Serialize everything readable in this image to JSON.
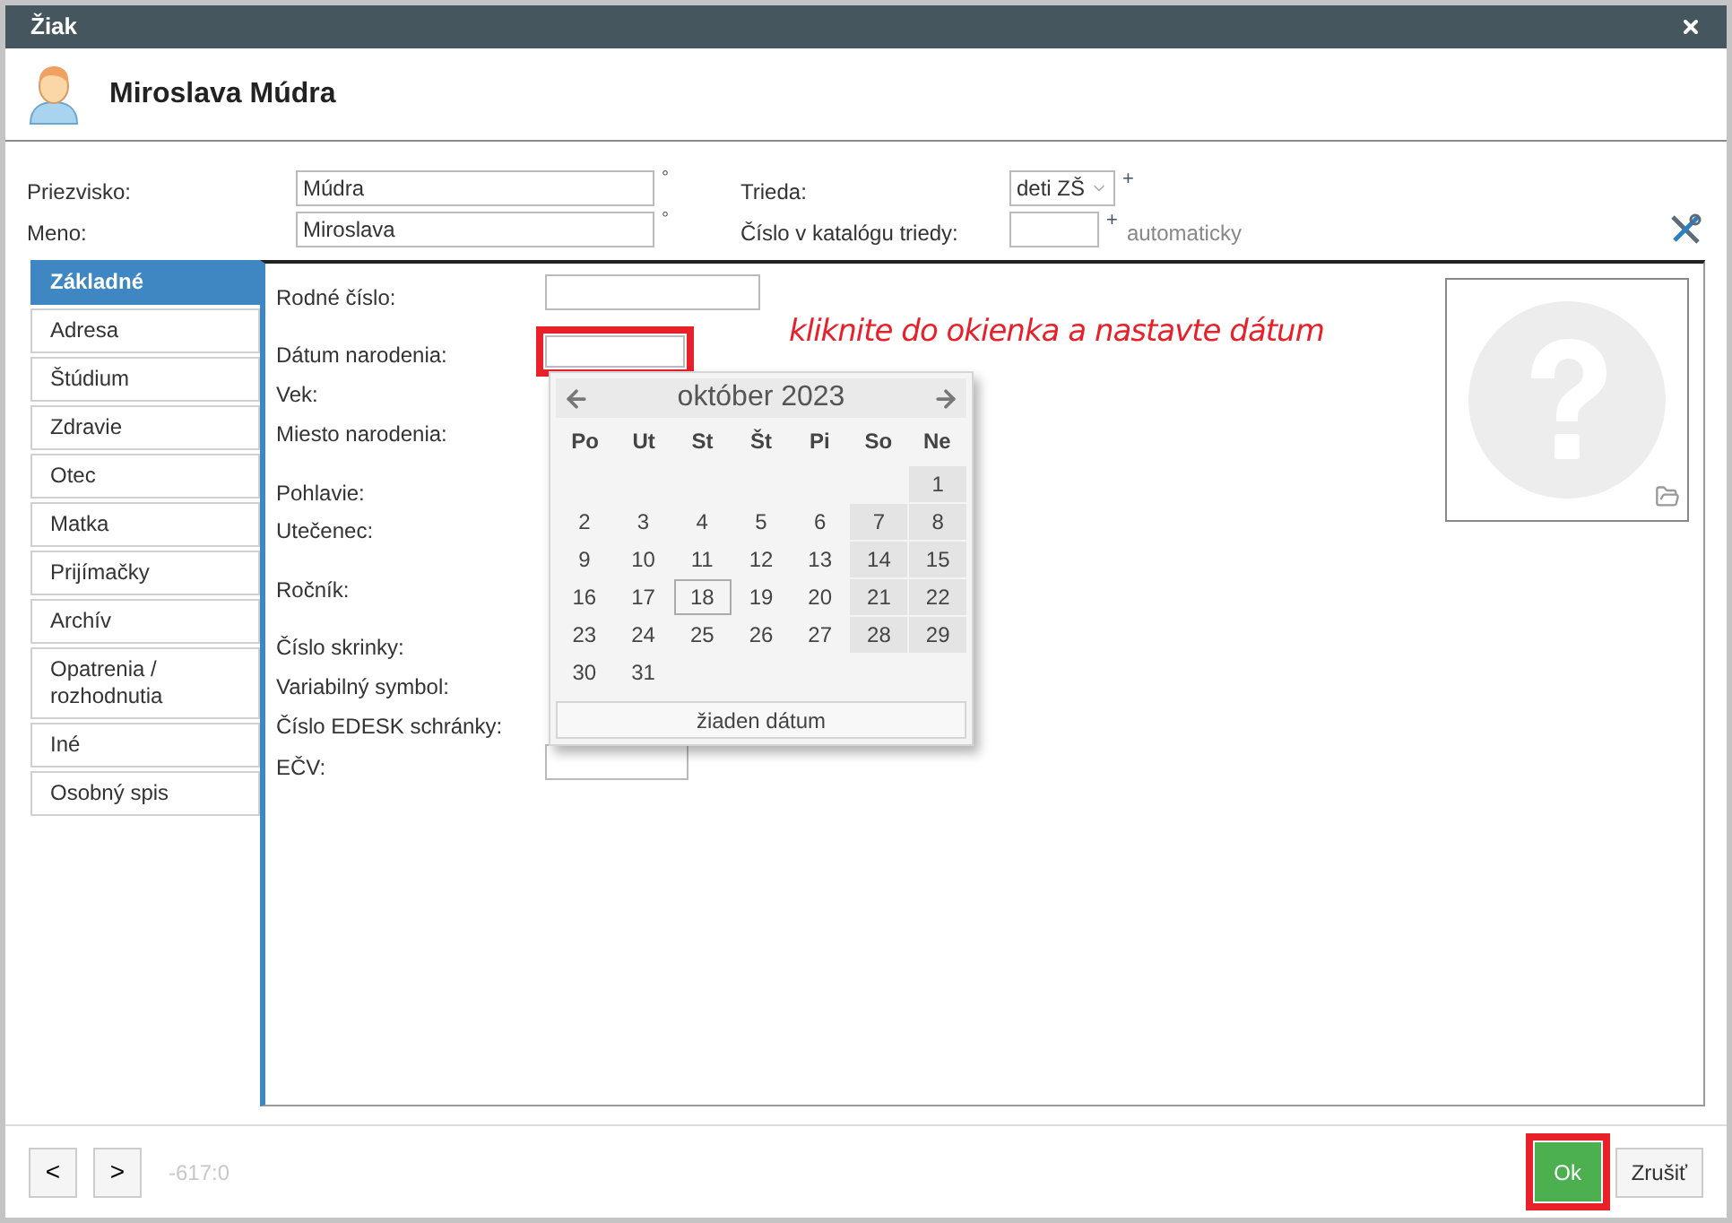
{
  "window": {
    "title": "Žiak"
  },
  "header": {
    "name": "Miroslava Múdra"
  },
  "personal": [
    {
      "label": "Priezvisko:",
      "value": "Múdra",
      "marker": "°"
    },
    {
      "label": "Meno:",
      "value": "Miroslava",
      "marker": "°"
    }
  ],
  "class_select": {
    "label": "Trieda:",
    "value": "deti ZŠ",
    "marker": "+"
  },
  "catalog": {
    "label": "Číslo v katalógu triedy:",
    "marker": "+",
    "hint": "automaticky"
  },
  "tabs": [
    {
      "label": "Základné",
      "selected": true
    },
    {
      "label": "Adresa",
      "selected": false
    },
    {
      "label": "Štúdium",
      "selected": false
    },
    {
      "label": "Zdravie",
      "selected": false
    },
    {
      "label": "Otec",
      "selected": false
    },
    {
      "label": "Matka",
      "selected": false
    },
    {
      "label": "Prijímačky",
      "selected": false
    },
    {
      "label": "Archív",
      "selected": false
    },
    {
      "label": "Opatrenia / rozhodnutia",
      "selected": false
    },
    {
      "label": "Iné",
      "selected": false
    },
    {
      "label": "Osobný spis",
      "selected": false
    }
  ],
  "fields": [
    {
      "label": "Rodné číslo:",
      "kind": "input",
      "highlighted": false
    },
    {
      "label": "Dátum narodenia:",
      "kind": "input",
      "highlighted": true
    },
    {
      "label": "Vek:",
      "kind": "label"
    },
    {
      "label": "Miesto narodenia:",
      "kind": "label"
    },
    {
      "label": "Pohlavie:",
      "kind": "label"
    },
    {
      "label": "Utečenec:",
      "kind": "label"
    },
    {
      "label": "Ročník:",
      "kind": "label"
    },
    {
      "label": "Číslo skrinky:",
      "kind": "label"
    },
    {
      "label": "Variabilný symbol:",
      "kind": "label"
    },
    {
      "label": "Číslo EDESK schránky:",
      "kind": "label"
    },
    {
      "label": "EČV:",
      "kind": "input",
      "highlighted": false
    }
  ],
  "annotation": {
    "text": "kliknite do okienka a nastavte dátum"
  },
  "calendar": {
    "title": "október 2023",
    "weekdays": [
      "Po",
      "Ut",
      "St",
      "Št",
      "Pi",
      "So",
      "Ne"
    ],
    "weeks": [
      [
        {
          "day": "1",
          "today": false
        }
      ],
      [
        {
          "day": "2",
          "today": false
        },
        {
          "day": "3",
          "today": false
        },
        {
          "day": "4",
          "today": false
        },
        {
          "day": "5",
          "today": false
        },
        {
          "day": "6",
          "today": false
        },
        {
          "day": "7",
          "today": false
        },
        {
          "day": "8",
          "today": false
        }
      ],
      [
        {
          "day": "9",
          "today": false
        },
        {
          "day": "10",
          "today": false
        },
        {
          "day": "11",
          "today": false
        },
        {
          "day": "12",
          "today": false
        },
        {
          "day": "13",
          "today": false
        },
        {
          "day": "14",
          "today": false
        },
        {
          "day": "15",
          "today": false
        }
      ],
      [
        {
          "day": "16",
          "today": false
        },
        {
          "day": "17",
          "today": false
        },
        {
          "day": "18",
          "today": true
        },
        {
          "day": "19",
          "today": false
        },
        {
          "day": "20",
          "today": false
        },
        {
          "day": "21",
          "today": false
        },
        {
          "day": "22",
          "today": false
        }
      ],
      [
        {
          "day": "23",
          "today": false
        },
        {
          "day": "24",
          "today": false
        },
        {
          "day": "25",
          "today": false
        },
        {
          "day": "26",
          "today": false
        },
        {
          "day": "27",
          "today": false
        },
        {
          "day": "28",
          "today": false
        },
        {
          "day": "29",
          "today": false
        }
      ],
      [
        {
          "day": "30",
          "today": false
        },
        {
          "day": "31",
          "today": false
        }
      ]
    ],
    "clear_button": "žiaden dátum"
  },
  "footer": {
    "prev": "<",
    "next": ">",
    "record": "-617:0",
    "ok": {
      "label": "Ok",
      "highlighted": true
    },
    "cancel": "Zrušiť"
  }
}
